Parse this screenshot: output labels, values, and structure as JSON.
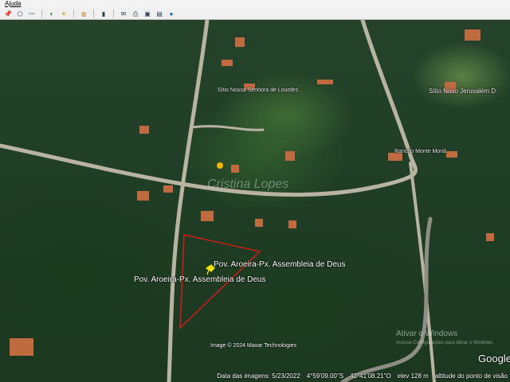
{
  "menu": {
    "help": "Ajuda"
  },
  "toolbar": {
    "icons": [
      "placemark-icon",
      "polygon-icon",
      "path-icon",
      "historical-imagery-icon",
      "sun-icon",
      "planets-icon",
      "ruler-icon",
      "email-icon",
      "print-icon",
      "save-image-icon",
      "map-icon",
      "earth-icon"
    ]
  },
  "map": {
    "places": [
      "Sítio Nossa Senhora de Lourdes",
      "Sítio Novo Jerusalém D",
      "Rancho Monte Moriá"
    ],
    "watermark": "Cristina Lopes",
    "placemark_label": "Pov. Aroeira-Px. Assembleia de Deus",
    "placemark_label_2": "Pov. Aroeira-Px. Assembleia de Deus",
    "copyright": "Image © 2024 Maxar Technologies",
    "activate_windows": "Ativar o Windows",
    "activate_windows_sub": "Acesse Configurações para ativar o Windows.",
    "logo": "Google",
    "polygon_color": "#d01c1c",
    "placemark_color": "#f5e400"
  },
  "status": {
    "imagery_date": "Data das imagens: 5/23/2022",
    "lat": "4°59'09.00\"S",
    "lon": "42°41'08.21\"O",
    "elev": "elev  128 m",
    "eye_alt": "altitude do ponto de visão"
  }
}
